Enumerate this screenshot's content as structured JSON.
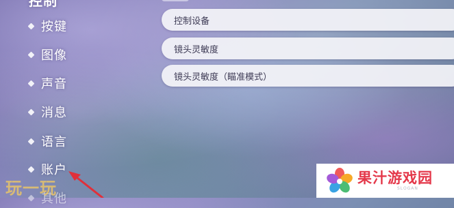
{
  "sidebar": {
    "items": [
      {
        "label": "控制",
        "state": "active"
      },
      {
        "label": "按键"
      },
      {
        "label": "图像"
      },
      {
        "label": "声音"
      },
      {
        "label": "消息"
      },
      {
        "label": "语言"
      },
      {
        "label": "账户"
      },
      {
        "label": "其他",
        "state": "cut-off"
      }
    ]
  },
  "settings": {
    "options": [
      {
        "label": "控制设备"
      },
      {
        "label": "镜头灵敏度"
      },
      {
        "label": "镜头灵敏度（瞄准模式）"
      }
    ]
  },
  "annotation": {
    "icon": "red-arrow-icon",
    "color": "#e0303a"
  },
  "watermark_left": {
    "text": "玩一玩",
    "color": "#e8c46a"
  },
  "brand": {
    "name": "果汁游戏园",
    "slogan": "SLOGAN",
    "icon": "flower-logo-icon",
    "color": "#e4384a"
  }
}
